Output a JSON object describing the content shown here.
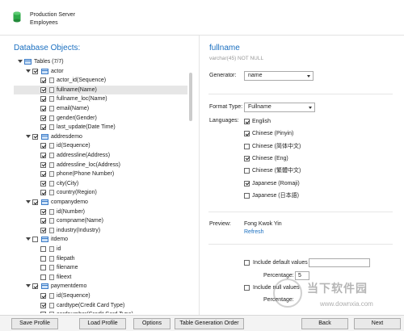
{
  "header": {
    "server": "Production Server",
    "database": "Employees"
  },
  "left": {
    "title": "Database Objects:",
    "tree": [
      {
        "level": 0,
        "expander": true,
        "checkbox": false,
        "icon": "table-group-icon",
        "label": "Tables (7/7)"
      },
      {
        "level": 1,
        "expander": true,
        "checkbox": true,
        "checked": true,
        "icon": "table-icon",
        "label": "actor"
      },
      {
        "level": 2,
        "checkbox": true,
        "checked": true,
        "icon": "column-icon",
        "label": "actor_id(Sequence)"
      },
      {
        "level": 2,
        "checkbox": true,
        "checked": true,
        "icon": "column-icon",
        "label": "fullname(Name)",
        "selected": true
      },
      {
        "level": 2,
        "checkbox": true,
        "checked": true,
        "icon": "column-icon",
        "label": "fullname_loc(Name)"
      },
      {
        "level": 2,
        "checkbox": true,
        "checked": true,
        "icon": "column-icon",
        "label": "email(Name)"
      },
      {
        "level": 2,
        "checkbox": true,
        "checked": true,
        "icon": "column-icon",
        "label": "gender(Gender)"
      },
      {
        "level": 2,
        "checkbox": true,
        "checked": true,
        "icon": "column-icon",
        "label": "last_update(Date Time)"
      },
      {
        "level": 1,
        "expander": true,
        "checkbox": true,
        "checked": true,
        "icon": "table-icon",
        "label": "addresdemo"
      },
      {
        "level": 2,
        "checkbox": true,
        "checked": true,
        "icon": "column-icon",
        "label": "id(Sequence)"
      },
      {
        "level": 2,
        "checkbox": true,
        "checked": true,
        "icon": "column-icon",
        "label": "addressline(Address)"
      },
      {
        "level": 2,
        "checkbox": true,
        "checked": true,
        "icon": "column-icon",
        "label": "addressline_loc(Address)"
      },
      {
        "level": 2,
        "checkbox": true,
        "checked": true,
        "icon": "column-icon",
        "label": "phone(Phone Number)"
      },
      {
        "level": 2,
        "checkbox": true,
        "checked": true,
        "icon": "column-icon",
        "label": "city(City)"
      },
      {
        "level": 2,
        "checkbox": true,
        "checked": true,
        "icon": "column-icon",
        "label": "country(Region)"
      },
      {
        "level": 1,
        "expander": true,
        "checkbox": true,
        "checked": true,
        "icon": "table-icon",
        "label": "companydemo"
      },
      {
        "level": 2,
        "checkbox": true,
        "checked": true,
        "icon": "column-icon",
        "label": "id(Number)"
      },
      {
        "level": 2,
        "checkbox": true,
        "checked": true,
        "icon": "column-icon",
        "label": "compname(Name)"
      },
      {
        "level": 2,
        "checkbox": true,
        "checked": true,
        "icon": "column-icon",
        "label": "industry(Industry)"
      },
      {
        "level": 1,
        "expander": true,
        "checkbox": true,
        "checked": false,
        "icon": "table-icon",
        "label": "itdemo"
      },
      {
        "level": 2,
        "checkbox": true,
        "checked": false,
        "icon": "column-icon",
        "label": "id"
      },
      {
        "level": 2,
        "checkbox": true,
        "checked": false,
        "icon": "column-icon",
        "label": "filepath"
      },
      {
        "level": 2,
        "checkbox": true,
        "checked": false,
        "icon": "column-icon",
        "label": "filename"
      },
      {
        "level": 2,
        "checkbox": true,
        "checked": false,
        "icon": "column-icon",
        "label": "fileext"
      },
      {
        "level": 1,
        "expander": true,
        "checkbox": true,
        "checked": true,
        "icon": "table-icon",
        "label": "paymentdemo"
      },
      {
        "level": 2,
        "checkbox": true,
        "checked": true,
        "icon": "column-icon",
        "label": "id(Sequence)"
      },
      {
        "level": 2,
        "checkbox": true,
        "checked": true,
        "icon": "column-icon",
        "label": "cardtype(Credit Card Type)"
      },
      {
        "level": 2,
        "checkbox": true,
        "checked": true,
        "icon": "column-icon",
        "label": "cardnumber(Credit Card Type)"
      }
    ]
  },
  "right": {
    "title": "fullname",
    "subtitle": "varchar(45) NOT NULL",
    "generator_label": "Generator:",
    "generator_value": "name",
    "format_label": "Format Type:",
    "format_value": "Fullname",
    "languages_label": "Languages:",
    "languages": [
      {
        "label": "English",
        "checked": true
      },
      {
        "label": "Chinese (Pinyin)",
        "checked": true
      },
      {
        "label": "Chinese (简体中文)",
        "checked": false
      },
      {
        "label": "Chinese (Eng)",
        "checked": true
      },
      {
        "label": "Chinese (繁體中文)",
        "checked": false
      },
      {
        "label": "Japanese (Romaji)",
        "checked": true
      },
      {
        "label": "Japanese (日本語)",
        "checked": false
      }
    ],
    "preview_label": "Preview:",
    "preview_value": "Fong Kwok Yin",
    "refresh_label": "Refresh",
    "include_default_label": "Include default values",
    "percentage_label": "Percentage:",
    "percentage_value": "5",
    "include_null_label": "Include null values",
    "percentage2_label": "Percentage:"
  },
  "footer": {
    "save_profile": "Save Profile",
    "load_profile": "Load Profile",
    "options": "Options",
    "table_generation_order": "Table Generation Order",
    "back": "Back",
    "next": "Next"
  },
  "watermark": {
    "text": "当下软件园",
    "url": "www.downxia.com"
  },
  "colors": {
    "accent": "#1a6fc0",
    "db_icon": "#2faa4a"
  }
}
